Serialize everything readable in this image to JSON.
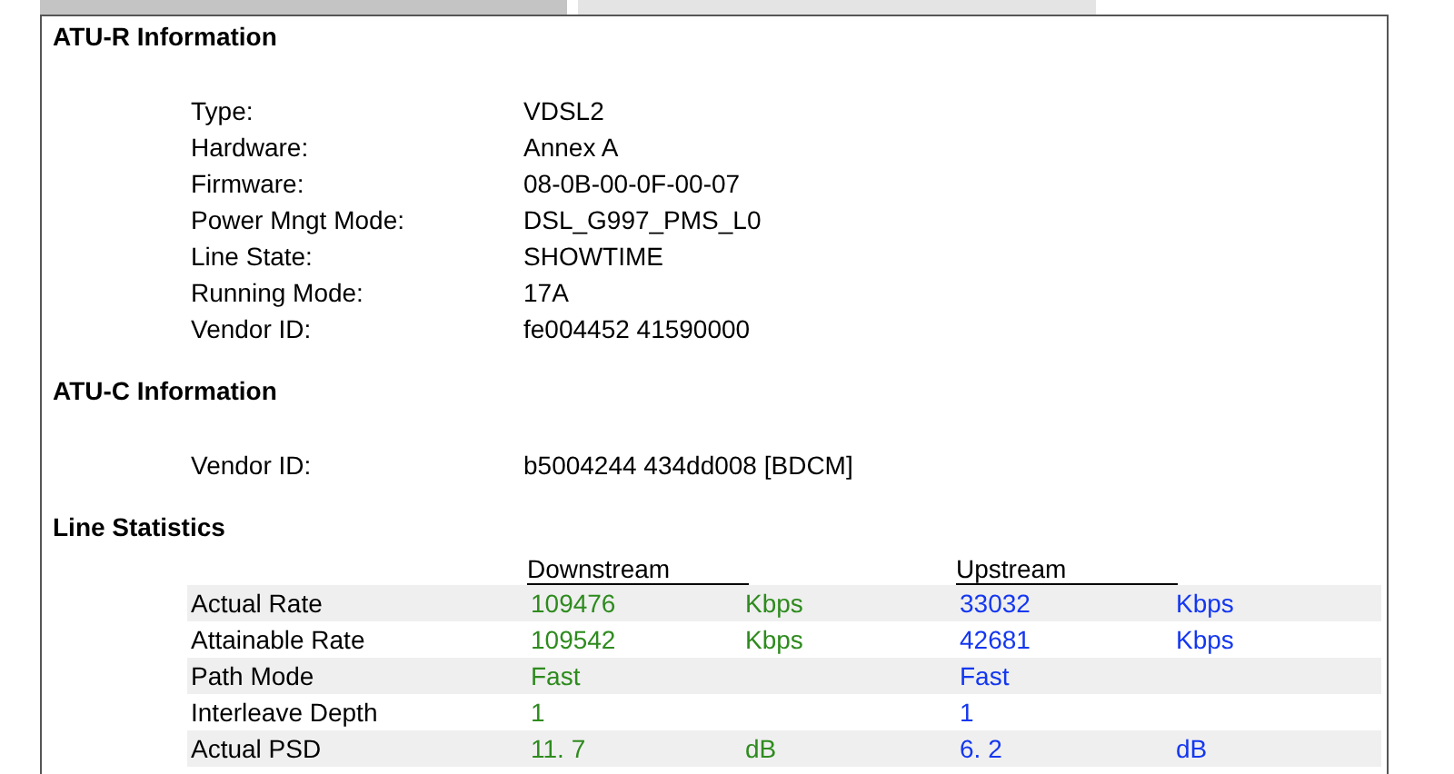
{
  "sections": [
    {
      "title": "ATU-R Information",
      "fields": [
        {
          "label": "Type:",
          "value": "VDSL2"
        },
        {
          "label": "Hardware:",
          "value": "Annex A"
        },
        {
          "label": "Firmware:",
          "value": "08-0B-00-0F-00-07"
        },
        {
          "label": "Power Mngt Mode:",
          "value": "DSL_G997_PMS_L0"
        },
        {
          "label": "Line State:",
          "value": "SHOWTIME"
        },
        {
          "label": "Running Mode:",
          "value": "17A"
        },
        {
          "label": "Vendor ID:",
          "value": "fe004452 41590000"
        }
      ]
    },
    {
      "title": "ATU-C Information",
      "fields": [
        {
          "label": "Vendor ID:",
          "value": "b5004244 434dd008 [BDCM]"
        }
      ]
    }
  ],
  "line_statistics": {
    "title": "Line Statistics",
    "columns": [
      "Downstream",
      "Upstream"
    ],
    "rows": [
      {
        "label": "Actual Rate",
        "down": "109476",
        "down_unit": "Kbps",
        "up": "33032",
        "up_unit": "Kbps"
      },
      {
        "label": "Attainable Rate",
        "down": "109542",
        "down_unit": "Kbps",
        "up": "42681",
        "up_unit": "Kbps"
      },
      {
        "label": "Path Mode",
        "down": "Fast",
        "up": "Fast"
      },
      {
        "label": "Interleave Depth",
        "down": "1",
        "up": "1"
      },
      {
        "label": "Actual PSD",
        "down": "11. 7",
        "down_unit": "dB",
        "up": "6. 2",
        "up_unit": "dB"
      }
    ]
  }
}
